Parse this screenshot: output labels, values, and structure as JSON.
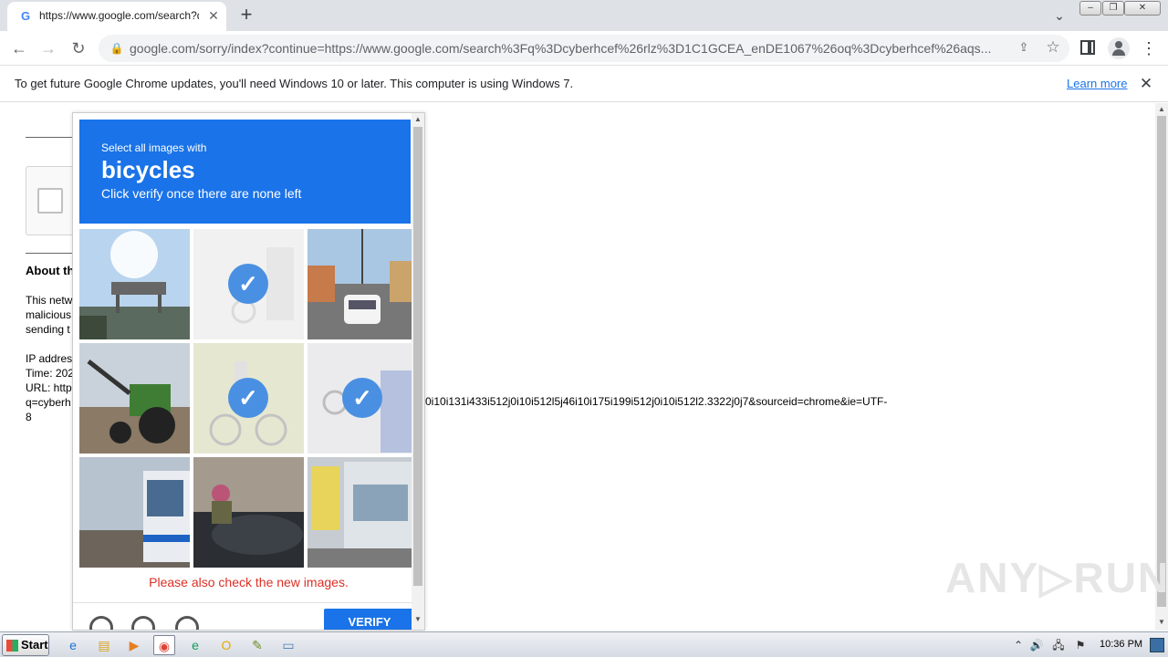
{
  "browser": {
    "tab": {
      "favicon": "G",
      "title": "https://www.google.com/search?q=",
      "close_glyph": "✕"
    },
    "new_tab_glyph": "+",
    "tab_search_glyph": "⌄",
    "window_controls": {
      "minimize": "‒",
      "maximize": "❐",
      "close": "✕"
    },
    "nav": {
      "back": "←",
      "forward": "→",
      "reload": "↻"
    },
    "omnibox": {
      "lock": "🔒",
      "url": "google.com/sorry/index?continue=https://www.google.com/search%3Fq%3Dcyberhcef%26rlz%3D1C1GCEA_enDE1067%26oq%3Dcyberhcef%26aqs..."
    },
    "toolbar_icons": {
      "share": "⇪",
      "star": "☆",
      "menu": "⋮"
    }
  },
  "infobar": {
    "text": "To get future Google Chrome updates, you'll need Windows 10 or later. This computer is using Windows 7.",
    "link": "Learn more",
    "close": "✕"
  },
  "page": {
    "about_heading": "About th",
    "para_lines": [
      "This netw",
      "malicious",
      "sending t"
    ],
    "info_lines": [
      "IP addres",
      "Time: 202",
      "URL: http",
      "q=cyberh",
      "8"
    ],
    "url_tail": "0i10i131i433i512j0i10i512l5j46i10i175i199i512j0i10i512l2.3322j0j7&sourceid=chrome&ie=UTF-"
  },
  "captcha": {
    "instruction": "Select all images with",
    "object": "bicycles",
    "subtext": "Click verify once there are none left",
    "error": "Please also check the new images.",
    "verify_label": "VERIFY",
    "tiles": [
      {
        "scene": "sky-overpass",
        "selected": false
      },
      {
        "scene": "faded-street",
        "selected": true
      },
      {
        "scene": "street-van",
        "selected": false
      },
      {
        "scene": "tractor",
        "selected": false
      },
      {
        "scene": "cyclist",
        "selected": true
      },
      {
        "scene": "street-bicycle",
        "selected": true
      },
      {
        "scene": "bus",
        "selected": false
      },
      {
        "scene": "motorcycle-rider",
        "selected": false
      },
      {
        "scene": "building-sign",
        "selected": false
      }
    ]
  },
  "watermark": "ANY▷RUN",
  "taskbar": {
    "start_label": "Start",
    "apps": [
      {
        "name": "ie",
        "glyph": "e",
        "color": "#1e73d2"
      },
      {
        "name": "explorer",
        "glyph": "▤",
        "color": "#d9a520"
      },
      {
        "name": "media",
        "glyph": "▶",
        "color": "#e67e22"
      },
      {
        "name": "chrome",
        "glyph": "◉",
        "color": "#db4437"
      },
      {
        "name": "edge",
        "glyph": "e",
        "color": "#0f9d58"
      },
      {
        "name": "outlook",
        "glyph": "O",
        "color": "#e6a800"
      },
      {
        "name": "notepad",
        "glyph": "✎",
        "color": "#6b8e23"
      },
      {
        "name": "app",
        "glyph": "▭",
        "color": "#4a7fb5"
      }
    ],
    "tray": [
      "⌃",
      "🔊",
      "🖧",
      "⚑"
    ],
    "clock": "10:36 PM"
  }
}
